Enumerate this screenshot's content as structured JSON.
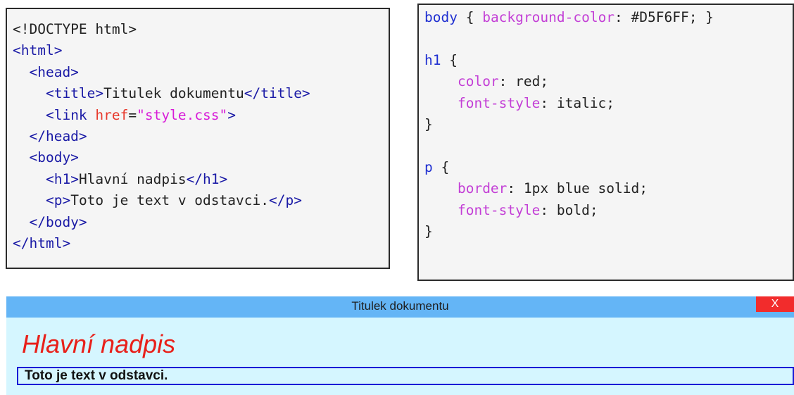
{
  "html_code": {
    "lines": [
      [
        {
          "t": "<!DOCTYPE html>",
          "c": "txt"
        }
      ],
      [
        {
          "t": "<html>",
          "c": "tag"
        }
      ],
      [
        {
          "t": "  ",
          "c": "txt"
        },
        {
          "t": "<head>",
          "c": "tag"
        }
      ],
      [
        {
          "t": "    ",
          "c": "txt"
        },
        {
          "t": "<title>",
          "c": "tag"
        },
        {
          "t": "Titulek dokumentu",
          "c": "txt"
        },
        {
          "t": "</title>",
          "c": "tag"
        }
      ],
      [
        {
          "t": "    ",
          "c": "txt"
        },
        {
          "t": "<link ",
          "c": "tag"
        },
        {
          "t": "href",
          "c": "attr"
        },
        {
          "t": "=",
          "c": "txt"
        },
        {
          "t": "\"style.css\"",
          "c": "str"
        },
        {
          "t": ">",
          "c": "tag"
        }
      ],
      [
        {
          "t": "  ",
          "c": "txt"
        },
        {
          "t": "</head>",
          "c": "tag"
        }
      ],
      [
        {
          "t": "  ",
          "c": "txt"
        },
        {
          "t": "<body>",
          "c": "tag"
        }
      ],
      [
        {
          "t": "    ",
          "c": "txt"
        },
        {
          "t": "<h1>",
          "c": "tag"
        },
        {
          "t": "Hlavní nadpis",
          "c": "txt"
        },
        {
          "t": "</h1>",
          "c": "tag"
        }
      ],
      [
        {
          "t": "    ",
          "c": "txt"
        },
        {
          "t": "<p>",
          "c": "tag"
        },
        {
          "t": "Toto je text v odstavci.",
          "c": "txt"
        },
        {
          "t": "</p>",
          "c": "tag"
        }
      ],
      [
        {
          "t": "  ",
          "c": "txt"
        },
        {
          "t": "</body>",
          "c": "tag"
        }
      ],
      [
        {
          "t": "</html>",
          "c": "tag"
        }
      ]
    ]
  },
  "css_code": {
    "lines": [
      [
        {
          "t": "body",
          "c": "sel"
        },
        {
          "t": " { ",
          "c": "txt"
        },
        {
          "t": "background-color",
          "c": "prop"
        },
        {
          "t": ": #D5F6FF; }",
          "c": "txt"
        }
      ],
      [],
      [
        {
          "t": "h1",
          "c": "sel"
        },
        {
          "t": " {",
          "c": "txt"
        }
      ],
      [
        {
          "t": "    ",
          "c": "txt"
        },
        {
          "t": "color",
          "c": "prop"
        },
        {
          "t": ": red;",
          "c": "txt"
        }
      ],
      [
        {
          "t": "    ",
          "c": "txt"
        },
        {
          "t": "font-style",
          "c": "prop"
        },
        {
          "t": ": italic;",
          "c": "txt"
        }
      ],
      [
        {
          "t": "}",
          "c": "txt"
        }
      ],
      [],
      [
        {
          "t": "p",
          "c": "sel"
        },
        {
          "t": " {",
          "c": "txt"
        }
      ],
      [
        {
          "t": "    ",
          "c": "txt"
        },
        {
          "t": "border",
          "c": "prop"
        },
        {
          "t": ": 1px blue solid;",
          "c": "txt"
        }
      ],
      [
        {
          "t": "    ",
          "c": "txt"
        },
        {
          "t": "font-style",
          "c": "prop"
        },
        {
          "t": ": bold;",
          "c": "txt"
        }
      ],
      [
        {
          "t": "}",
          "c": "txt"
        }
      ]
    ]
  },
  "browser": {
    "title": "Titulek dokumentu",
    "close_label": "X",
    "heading": "Hlavní nadpis",
    "paragraph": "Toto je text v odstavci.",
    "colors": {
      "page_background": "#d5f6ff",
      "titlebar": "#64b5f6",
      "close": "#f22c2c",
      "heading": "#e8201a",
      "paragraph_border": "#1a1ad6"
    }
  }
}
